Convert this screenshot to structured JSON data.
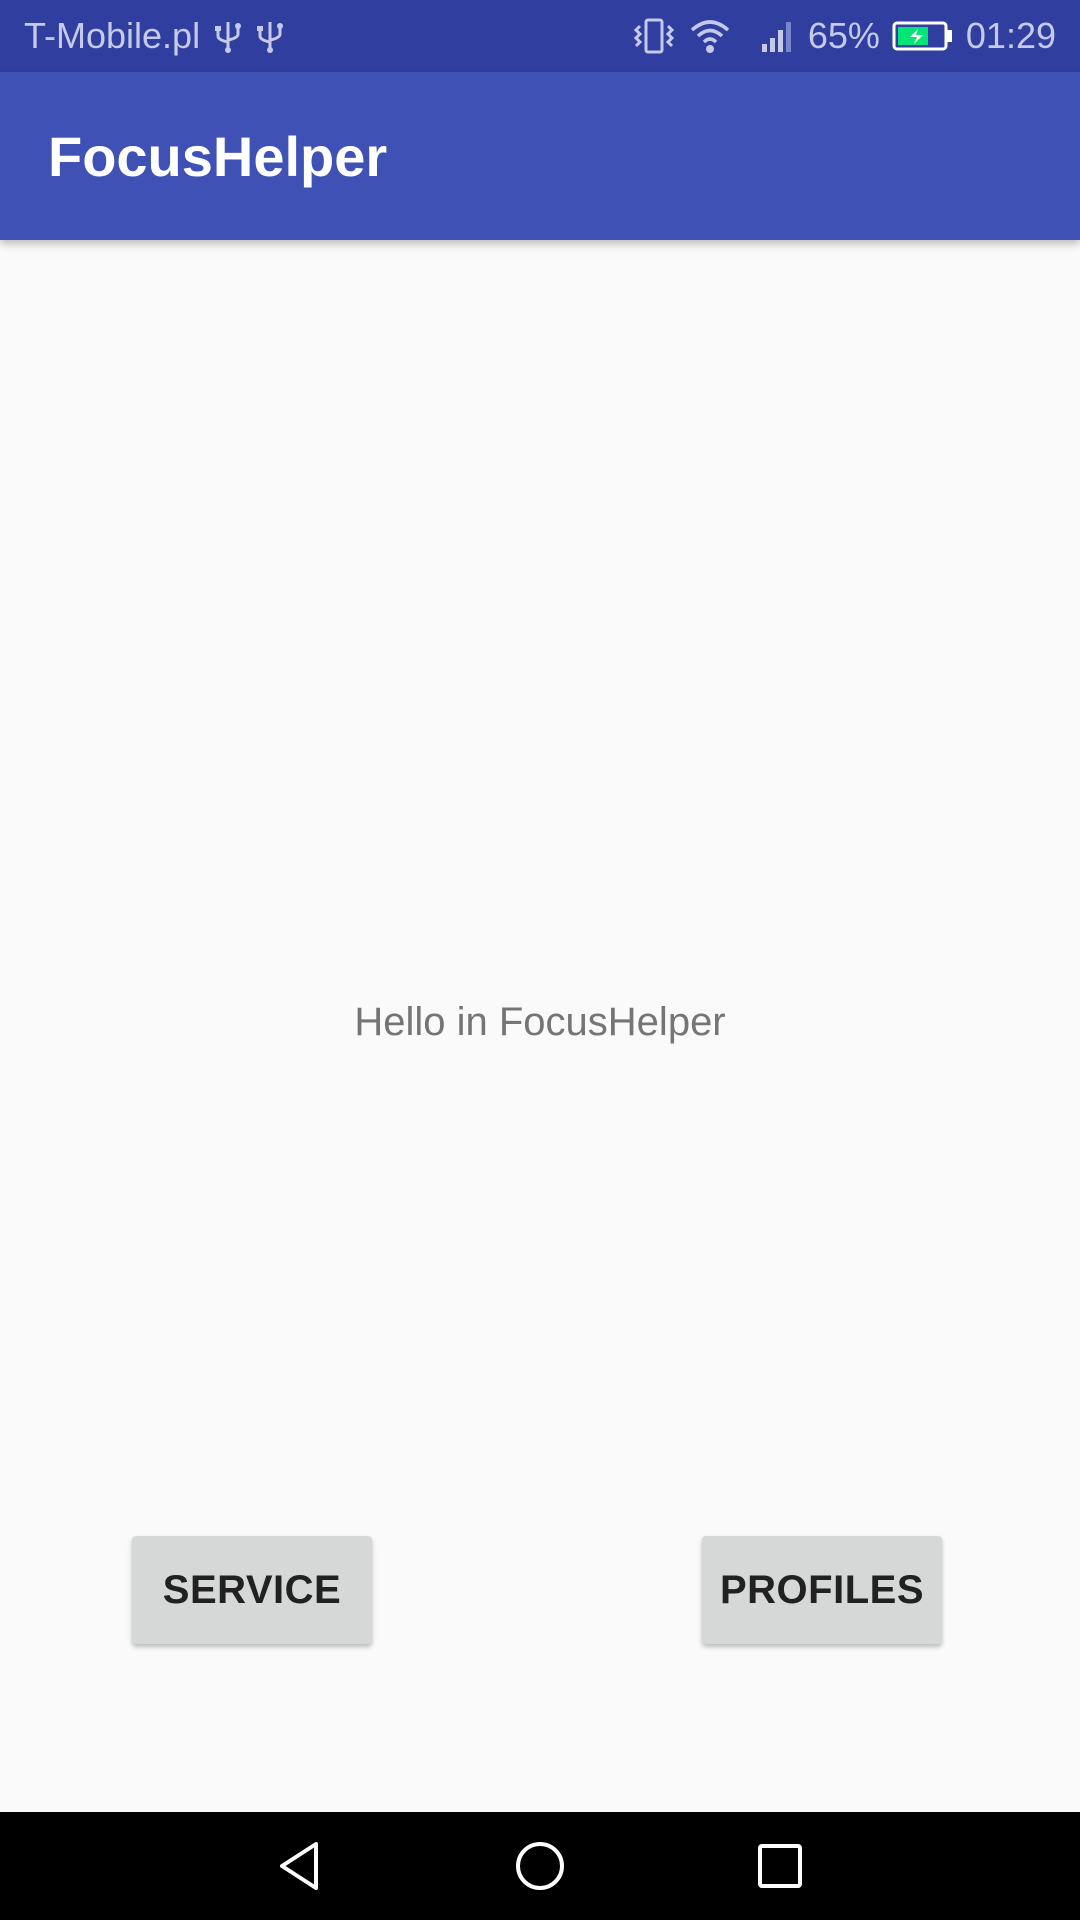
{
  "status_bar": {
    "carrier": "T-Mobile.pl",
    "left_icons": [
      "usb-icon",
      "usb-icon"
    ],
    "right_icons": [
      "vibrate-icon",
      "wifi-icon",
      "signal-icon"
    ],
    "battery_percent": "65%",
    "battery_icon": "battery-charging-icon",
    "time": "01:29"
  },
  "app_bar": {
    "title": "FocusHelper"
  },
  "main": {
    "message": "Hello in FocusHelper",
    "buttons": {
      "service_label": "SERVICE",
      "profiles_label": "PROFILES"
    }
  },
  "nav_bar": {
    "icons": [
      "back-icon",
      "home-icon",
      "recents-icon"
    ]
  },
  "colors": {
    "status_bar": "#303f9f",
    "app_bar": "#3f51b5",
    "background": "#fafafa",
    "button": "#d6d7d7",
    "battery_fill": "#00e676"
  }
}
